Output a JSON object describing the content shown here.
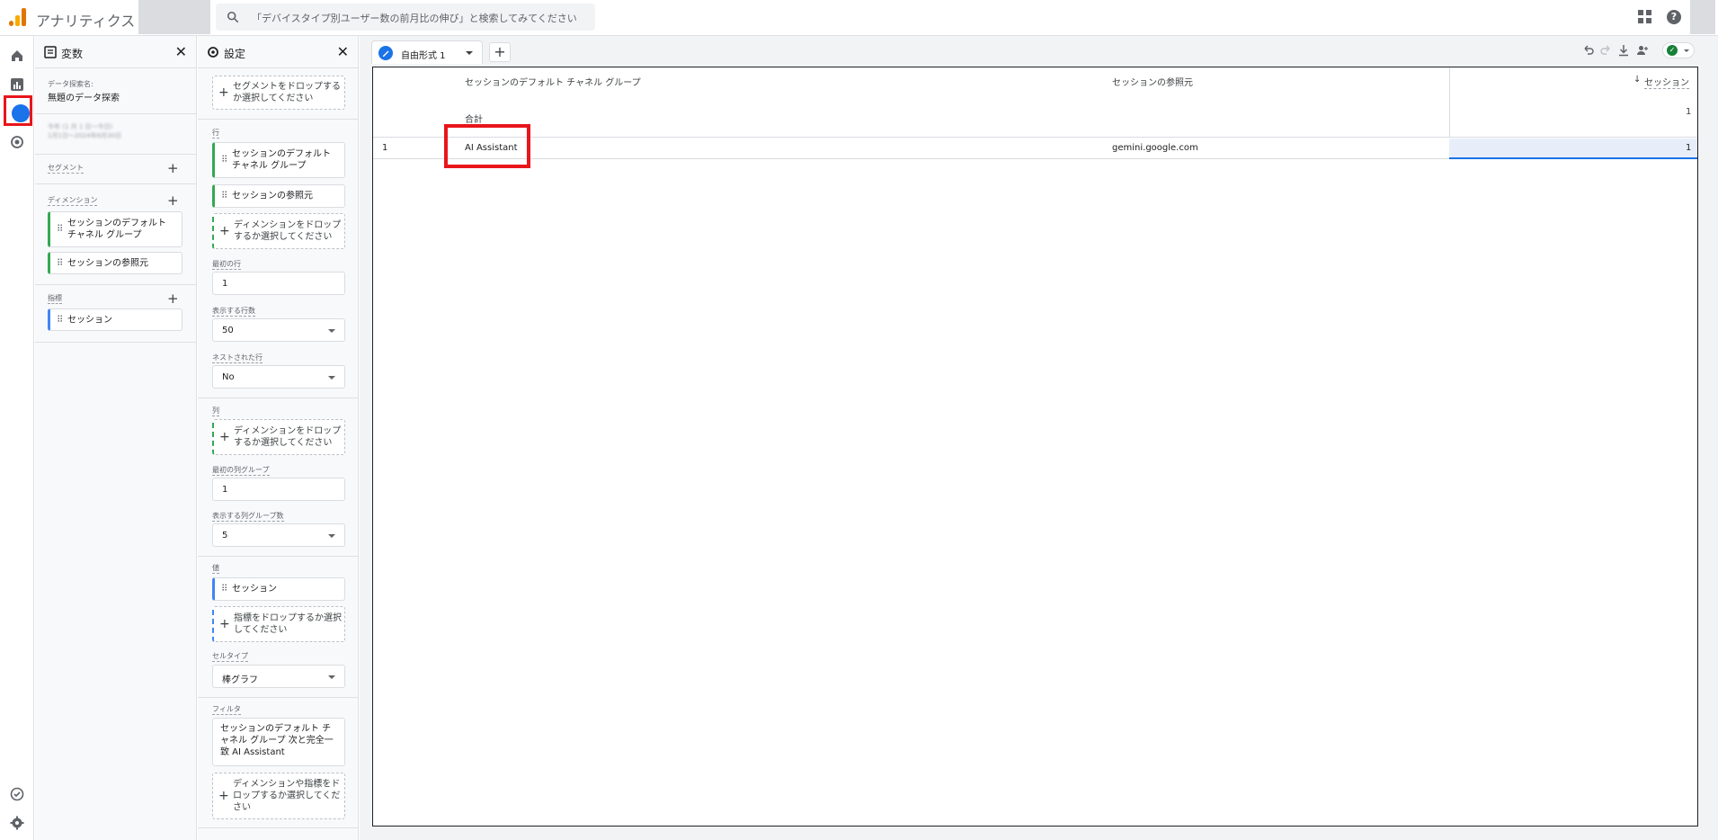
{
  "app": {
    "title": "アナリティクス",
    "search_placeholder": "「デバイスタイプ別ユーザー数の前月比の伸び」と検索してみてください",
    "help_symbol": "?"
  },
  "variables_panel": {
    "title": "変数",
    "close": "✕",
    "exploration_label": "データ探索名:",
    "exploration_name": "無題のデータ探索",
    "date_range_blurred": "今年 (1 月 1 日～今日)\n1月1日～2024年6月30日",
    "segment_label": "セグメント",
    "dimension_label": "ディメンション",
    "dimensions": [
      "セッションのデフォルト チャネル グループ",
      "セッションの参照元"
    ],
    "metric_label": "指標",
    "metrics": [
      "セッション"
    ]
  },
  "settings_panel": {
    "title": "設定",
    "close": "✕",
    "segment_drop": "セグメントをドロップするか選択してください",
    "rows_label": "行",
    "rows": [
      "セッションのデフォルト チャネル グループ",
      "セッションの参照元"
    ],
    "row_drop": "ディメンションをドロップするか選択してください",
    "first_row_label": "最初の行",
    "first_row_value": "1",
    "show_rows_label": "表示する行数",
    "show_rows_value": "50",
    "nested_rows_label": "ネストされた行",
    "nested_rows_value": "No",
    "columns_label": "列",
    "column_drop": "ディメンションをドロップするか選択してください",
    "first_col_group_label": "最初の列グループ",
    "first_col_group_value": "1",
    "show_col_groups_label": "表示する列グループ数",
    "show_col_groups_value": "5",
    "values_label": "値",
    "values": [
      "セッション"
    ],
    "metric_drop": "指標をドロップするか選択してください",
    "cell_type_label": "セルタイプ",
    "cell_type_value": "棒グラフ",
    "filter_label": "フィルタ",
    "filter_text": "セッションのデフォルト チャネル グループ 次と完全一致 AI Assistant",
    "filter_drop": "ディメンションや指標をドロップするか選択してください"
  },
  "main": {
    "tab_label": "自由形式 1",
    "add_tab": "+",
    "table": {
      "col_headers": [
        "セッションのデフォルト チャネル グループ",
        "セッションの参照元"
      ],
      "metric_header": "セッション",
      "sort_arrow": "↓",
      "total_label": "合計",
      "total_value": "1",
      "rows": [
        {
          "index": "1",
          "channel": "AI Assistant",
          "source": "gemini.google.com",
          "sessions": "1"
        }
      ]
    }
  },
  "colors": {
    "brand_blue": "#1a73e8",
    "highlight_red": "#e8151b",
    "dimension_green": "#34a853",
    "metric_blue": "#4285f4"
  }
}
